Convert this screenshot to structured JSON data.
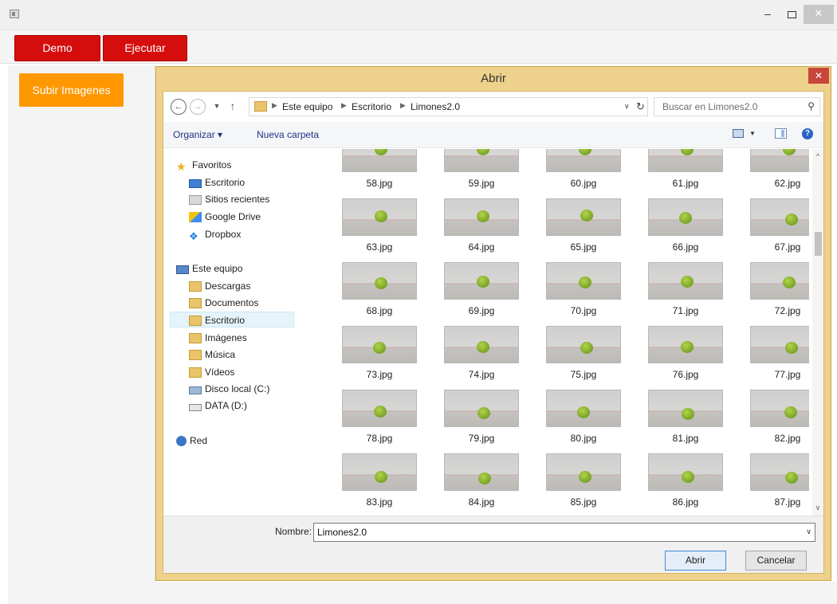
{
  "window": {
    "icon": "app-window-icon",
    "minimize": "–",
    "close": "✕"
  },
  "toolbar": {
    "demo_label": "Demo",
    "ejecutar_label": "Ejecutar"
  },
  "left_panel": {
    "subir_label": "Subir Imagenes"
  },
  "dialog": {
    "title": "Abrir",
    "close": "✕",
    "nav": {
      "breadcrumbs": [
        "Este equipo",
        "Escritorio",
        "Limones2.0"
      ],
      "search_placeholder": "Buscar en Limones2.0"
    },
    "commands": {
      "organizar": "Organizar ▾",
      "nueva_carpeta": "Nueva carpeta"
    },
    "navpane": {
      "favoritos": "Favoritos",
      "escritorio_fav": "Escritorio",
      "sitios": "Sitios recientes",
      "gdrive": "Google Drive",
      "dropbox": "Dropbox",
      "este_equipo": "Este equipo",
      "descargas": "Descargas",
      "documentos": "Documentos",
      "escritorio": "Escritorio",
      "imagenes": "Imágenes",
      "musica": "Música",
      "videos": "Vídeos",
      "disco": "Disco local (C:)",
      "data": "DATA (D:)",
      "red": "Red"
    },
    "files": [
      "58.jpg",
      "59.jpg",
      "60.jpg",
      "61.jpg",
      "62.jpg",
      "63.jpg",
      "64.jpg",
      "65.jpg",
      "66.jpg",
      "67.jpg",
      "68.jpg",
      "69.jpg",
      "70.jpg",
      "71.jpg",
      "72.jpg",
      "73.jpg",
      "74.jpg",
      "75.jpg",
      "76.jpg",
      "77.jpg",
      "78.jpg",
      "79.jpg",
      "80.jpg",
      "81.jpg",
      "82.jpg",
      "83.jpg",
      "84.jpg",
      "85.jpg",
      "86.jpg",
      "87.jpg"
    ],
    "nombre_label": "Nombre:",
    "nombre_value": "Limones2.0",
    "abrir_label": "Abrir",
    "cancelar_label": "Cancelar"
  },
  "colors": {
    "accent_red": "#d60d0d",
    "accent_orange": "#ff9800",
    "dialog_frame": "#eed18a",
    "close_red": "#c9463c"
  }
}
